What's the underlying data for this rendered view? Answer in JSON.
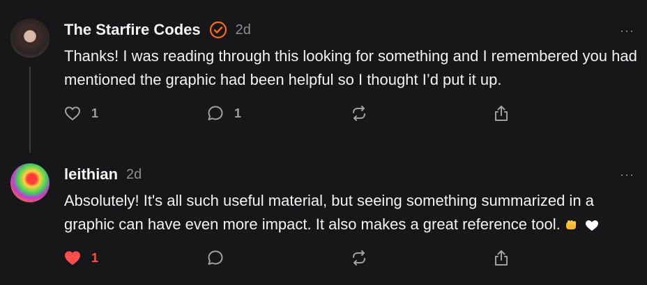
{
  "posts": [
    {
      "author": "The Starfire Codes",
      "time": "2d",
      "more": "···",
      "text": "Thanks! I was reading through this looking for something and I remembered you had mentioned the graphic had been helpful so I thought I’d put it up.",
      "likes": "1",
      "replies": "1",
      "liked": false,
      "verified": true
    },
    {
      "author": "leithian",
      "time": "2d",
      "more": "···",
      "text": "Absolutely! It's all such useful material, but seeing something summarized in a graphic can have even more impact. It also makes a great reference tool.",
      "likes": "1",
      "replies": "",
      "liked": true,
      "verified": false
    }
  ],
  "colors": {
    "accent_like": "#ff4d4d",
    "verified_badge": "#ff6a1a",
    "muted": "#8e8e93",
    "background": "#17171a"
  },
  "icons": [
    "heart-icon",
    "comment-icon",
    "repost-icon",
    "share-icon",
    "verified-icon",
    "more-icon"
  ]
}
